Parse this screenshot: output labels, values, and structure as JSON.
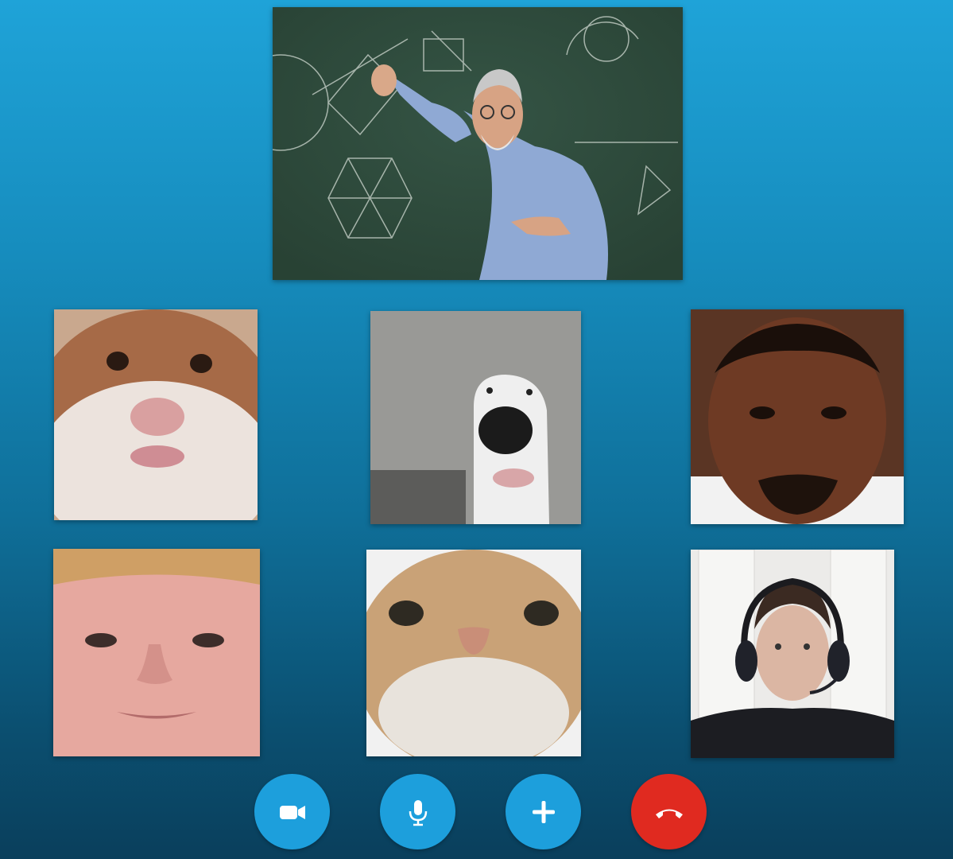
{
  "call": {
    "participants": [
      {
        "id": "presenter",
        "description_icon": "teacher-at-chalkboard-video"
      },
      {
        "id": "p1",
        "description_icon": "hamster-video"
      },
      {
        "id": "p2",
        "description_icon": "bull-terrier-video"
      },
      {
        "id": "p3",
        "description_icon": "man-video"
      },
      {
        "id": "p4",
        "description_icon": "man-closeup-video"
      },
      {
        "id": "p5",
        "description_icon": "cat-video"
      },
      {
        "id": "p6",
        "description_icon": "man-with-headset-video"
      }
    ]
  },
  "controls": {
    "video": {
      "icon": "video-camera-icon",
      "color": "#1d9fdc"
    },
    "mic": {
      "icon": "microphone-icon",
      "color": "#1d9fdc"
    },
    "add": {
      "icon": "plus-icon",
      "color": "#1d9fdc"
    },
    "end": {
      "icon": "hang-up-icon",
      "color": "#e02a20"
    }
  },
  "colors": {
    "background_top": "#1fa3d8",
    "background_bottom": "#0a3f5c",
    "accent": "#1d9fdc",
    "end_call": "#e02a20"
  }
}
